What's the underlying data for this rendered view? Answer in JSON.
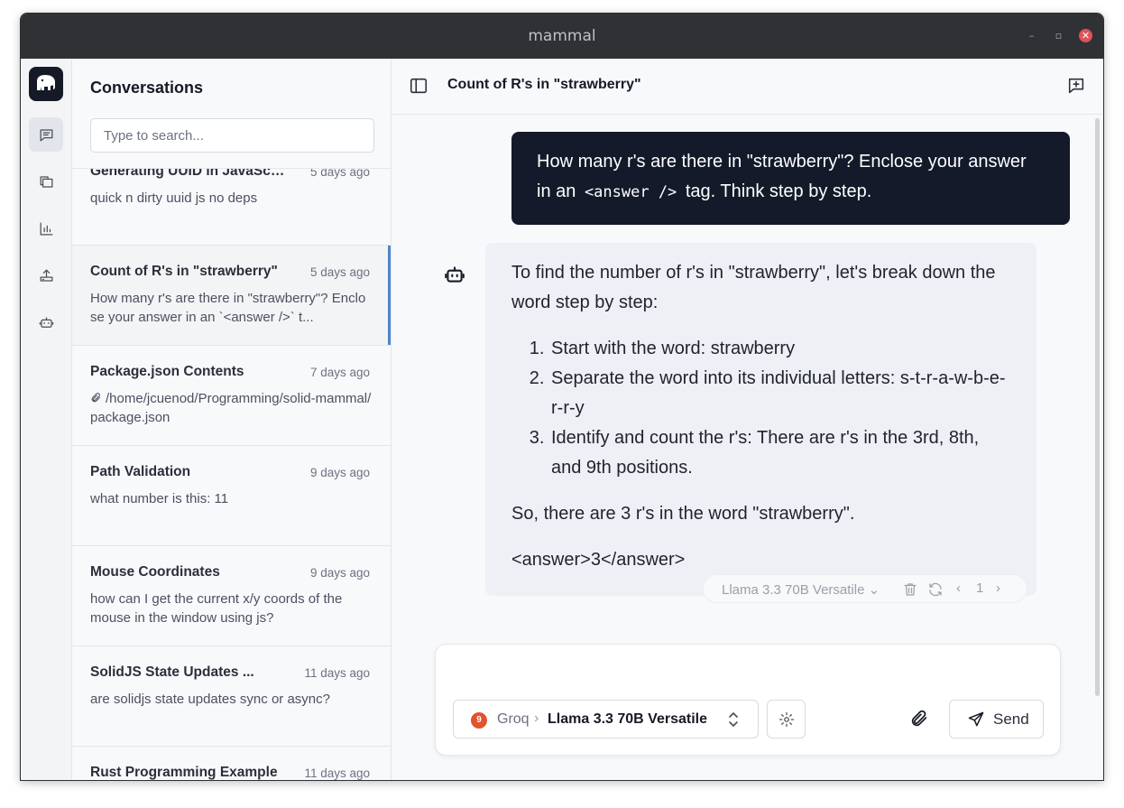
{
  "window": {
    "title": "mammal"
  },
  "sidebar": {
    "title": "Conversations",
    "search_placeholder": "Type to search...",
    "conversations": [
      {
        "title": "Generating UUID in JavaScript",
        "date": "5 days ago",
        "preview": "quick n dirty uuid js no deps",
        "attachment": false,
        "active": false
      },
      {
        "title": "Count of R's in \"strawberry\"",
        "date": "5 days ago",
        "preview": "How many r's are there in \"strawberry\"? Enclose your answer in an `<answer />` t...",
        "attachment": false,
        "active": true
      },
      {
        "title": "Package.json Contents",
        "date": "7 days ago",
        "preview": "/home/jcuenod/Programming/solid-mammal/package.json",
        "attachment": true,
        "active": false
      },
      {
        "title": "Path Validation",
        "date": "9 days ago",
        "preview": "what number is this: 11",
        "attachment": false,
        "active": false
      },
      {
        "title": "Mouse Coordinates",
        "date": "9 days ago",
        "preview": "how can I get the current x/y coords of the mouse in the window using js?",
        "attachment": false,
        "active": false
      },
      {
        "title": "SolidJS State Updates ...",
        "date": "11 days ago",
        "preview": "are solidjs state updates sync or async?",
        "attachment": false,
        "active": false
      },
      {
        "title": "Rust Programming Example",
        "date": "11 days ago",
        "preview": "",
        "attachment": false,
        "active": false
      }
    ]
  },
  "chat": {
    "title": "Count of R's in \"strawberry\"",
    "user_message": {
      "before": "How many r's are there in \"strawberry\"? Enclose your answer in an ",
      "code": "<answer />",
      "after": " tag. Think step by step."
    },
    "assistant_message": {
      "intro": "To find the number of r's in \"strawberry\", let's break down the word step by step:",
      "steps": [
        "Start with the word: strawberry",
        "Separate the word into its individual letters: s-t-r-a-w-b-e-r-r-y",
        "Identify and count the r's: There are r's in the 3rd, 8th, and 9th positions."
      ],
      "conclusion": "So, there are 3 r's in the word \"strawberry\".",
      "answer": "<answer>3</answer>",
      "model": "Llama 3.3 70B Versatile",
      "page": "1"
    }
  },
  "composer": {
    "placeholder": "",
    "provider_badge": "9",
    "provider": "Groq",
    "model": "Llama 3.3 70B Versatile",
    "send_label": "Send"
  },
  "colors": {
    "user_bubble": "#141a29",
    "assistant_bubble": "#eef0f5",
    "active_indicator": "#4a86c8",
    "provider_badge": "#e1522d"
  }
}
